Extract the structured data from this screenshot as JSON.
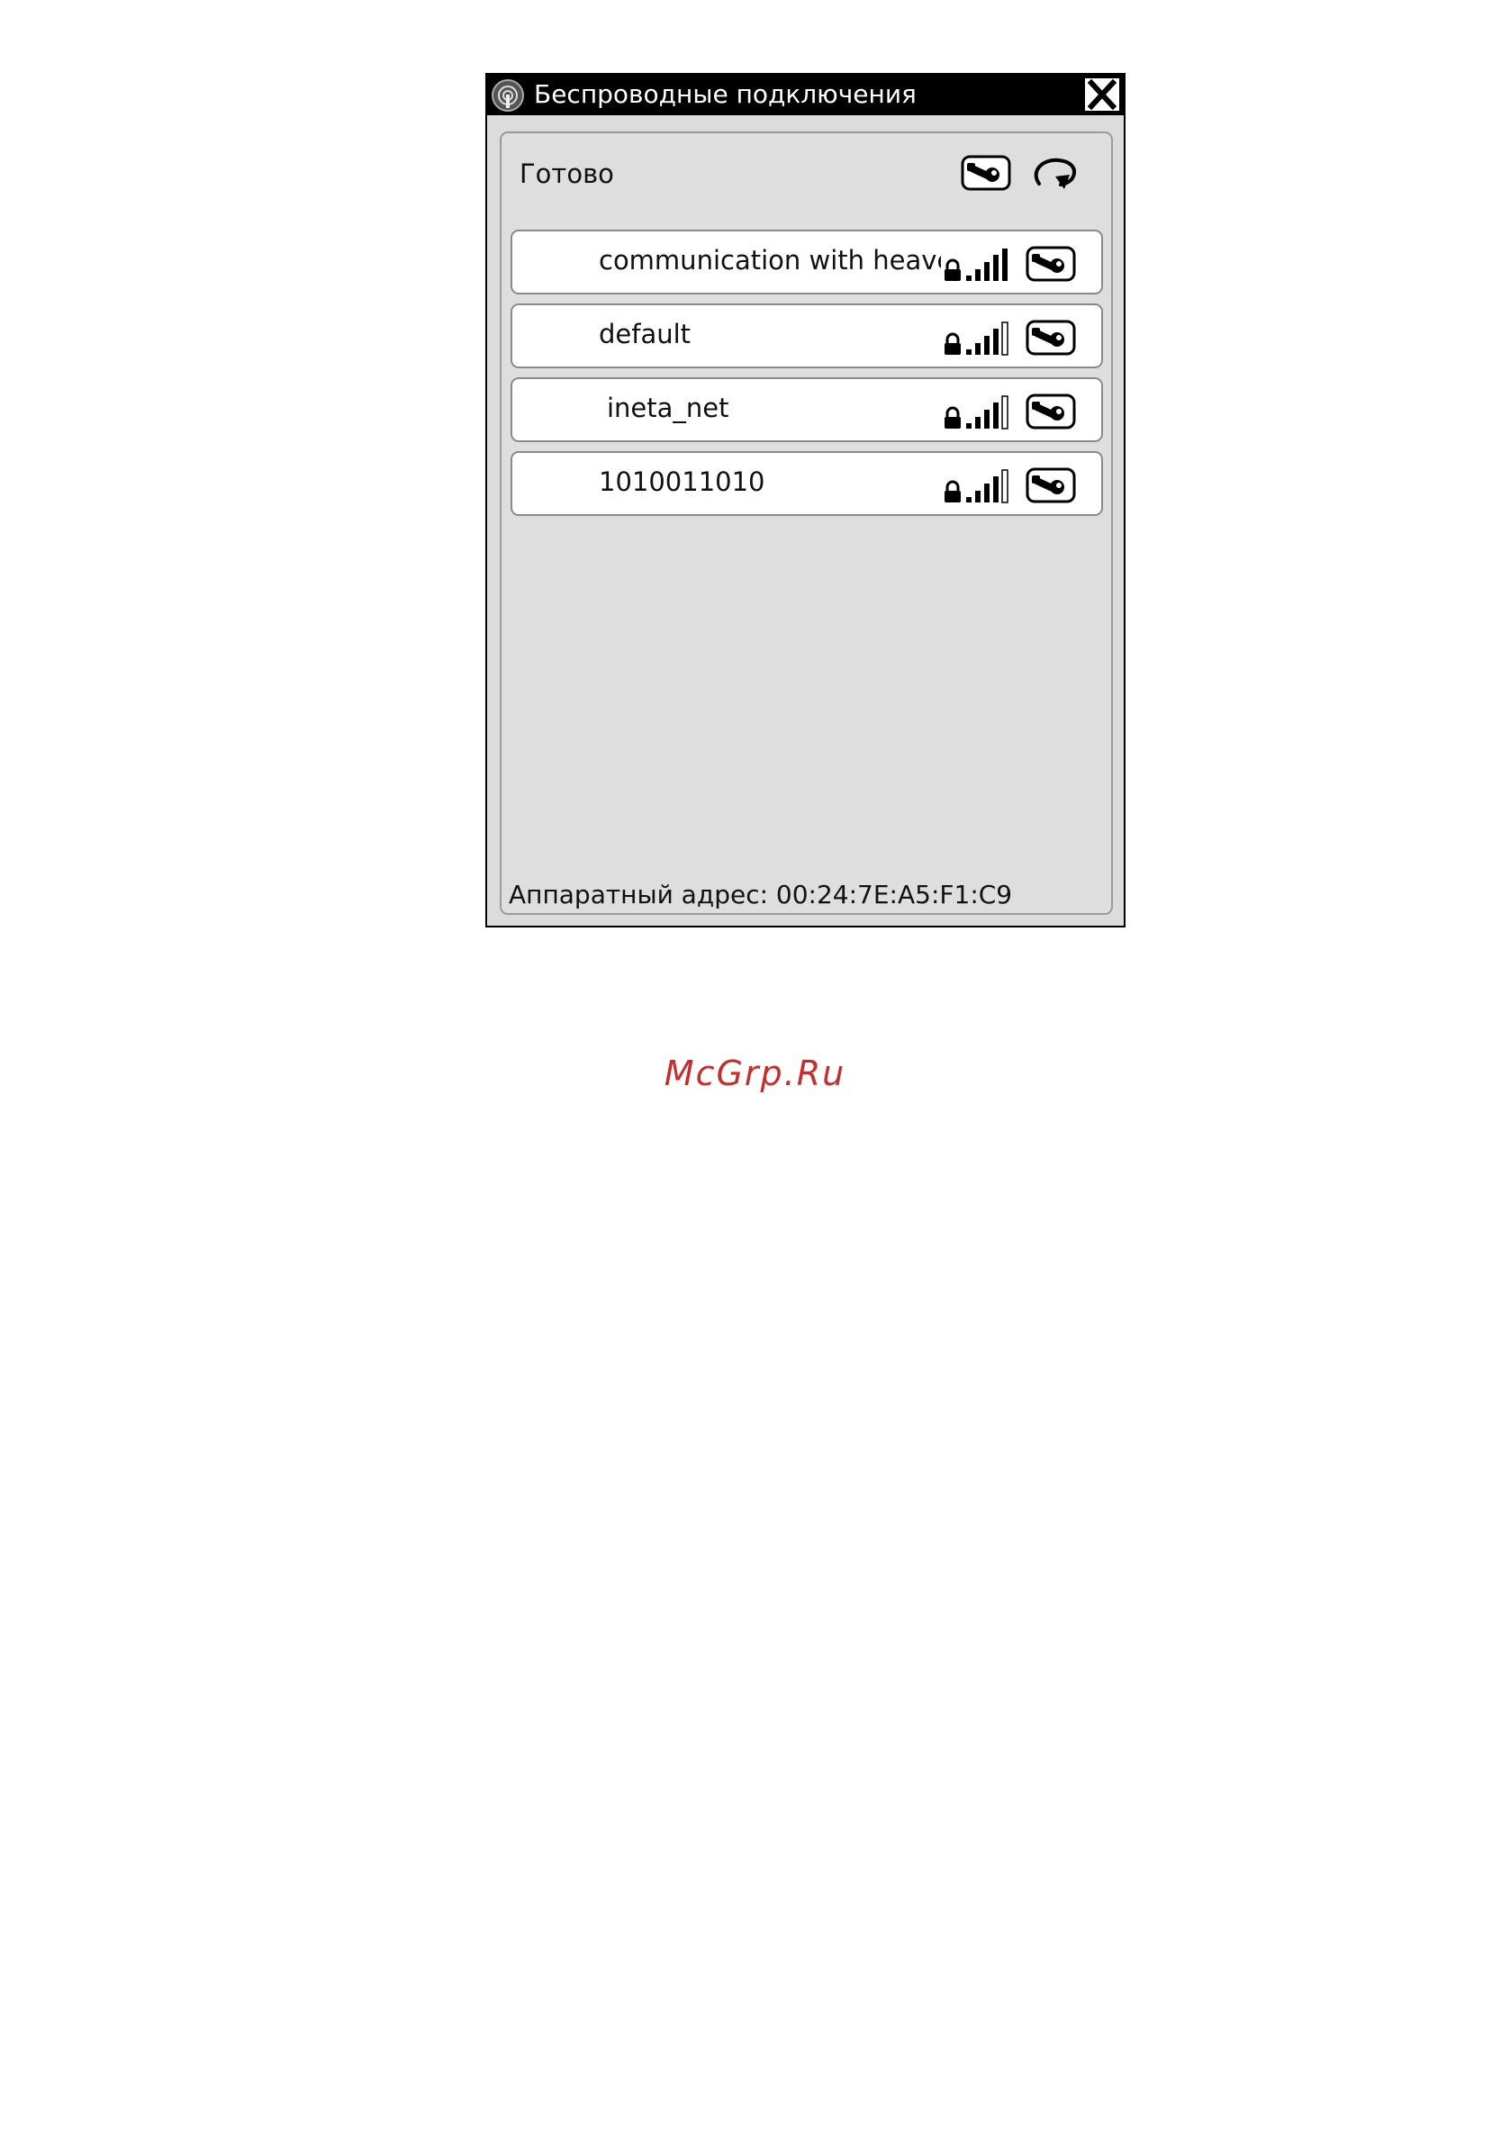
{
  "window": {
    "title": "Беспроводные подключения",
    "app_icon": "wifi-antenna-icon",
    "close_icon": "close-icon"
  },
  "panel": {
    "status": "Готово",
    "settings_icon": "wrench-icon",
    "refresh_icon": "refresh-icon"
  },
  "networks": [
    {
      "name": "communication with heaven",
      "secured": true,
      "signal_bars": 4,
      "settings_icon": "wrench-icon"
    },
    {
      "name": "default",
      "secured": true,
      "signal_bars": 3,
      "settings_icon": "wrench-icon"
    },
    {
      "name": "ineta_net",
      "secured": true,
      "signal_bars": 3,
      "settings_icon": "wrench-icon"
    },
    {
      "name": "1010011010",
      "secured": true,
      "signal_bars": 3,
      "settings_icon": "wrench-icon"
    }
  ],
  "footer": {
    "hardware_address": "Аппаратный адрес: 00:24:7E:A5:F1:C9"
  },
  "watermark": "McGrp.Ru"
}
